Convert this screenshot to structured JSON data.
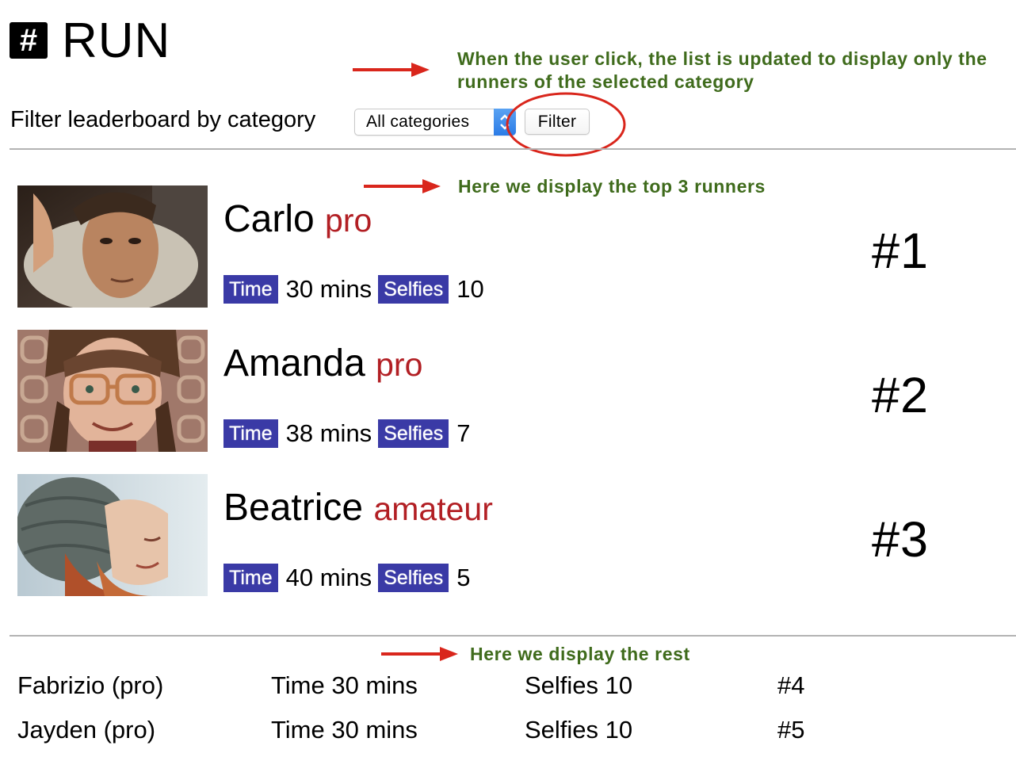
{
  "header": {
    "logo_glyph": "#",
    "title": "RUN"
  },
  "annotations": {
    "filter_note": "When the user click, the list is updated to display only the runners of the selected category",
    "filter_note_line1": "When the user click, the list is updated to display only the",
    "filter_note_line2": "runners of the selected category",
    "top_note": "Here we display the top 3 runners",
    "rest_note": "Here we display the rest",
    "color": "#3f6b1c",
    "arrow_color": "#d9261c"
  },
  "filter": {
    "label": "Filter leaderboard by category",
    "selected_option": "All categories",
    "button_label": "Filter"
  },
  "top_runners": [
    {
      "name": "Carlo",
      "category": "pro",
      "time_label": "Time",
      "time_value": "30 mins",
      "selfies_label": "Selfies",
      "selfies_value": "10",
      "rank": "#1",
      "photo": "man-portrait"
    },
    {
      "name": "Amanda",
      "category": "pro",
      "time_label": "Time",
      "time_value": "38 mins",
      "selfies_label": "Selfies",
      "selfies_value": "7",
      "rank": "#2",
      "photo": "girl-with-glasses-portrait"
    },
    {
      "name": "Beatrice",
      "category": "amateur",
      "time_label": "Time",
      "time_value": "40 mins",
      "selfies_label": "Selfies",
      "selfies_value": "5",
      "rank": "#3",
      "photo": "woman-in-knit-hat-portrait"
    }
  ],
  "rest_runners": [
    {
      "name": "Fabrizio (pro)",
      "time": "Time 30 mins",
      "selfies": "Selfies 10",
      "rank": "#4"
    },
    {
      "name": "Jayden (pro)",
      "time": "Time 30 mins",
      "selfies": "Selfies 10",
      "rank": "#5"
    }
  ],
  "colors": {
    "category": "#b21f24",
    "badge": "#3a3aa6",
    "highlight_circle": "#d9261c"
  }
}
